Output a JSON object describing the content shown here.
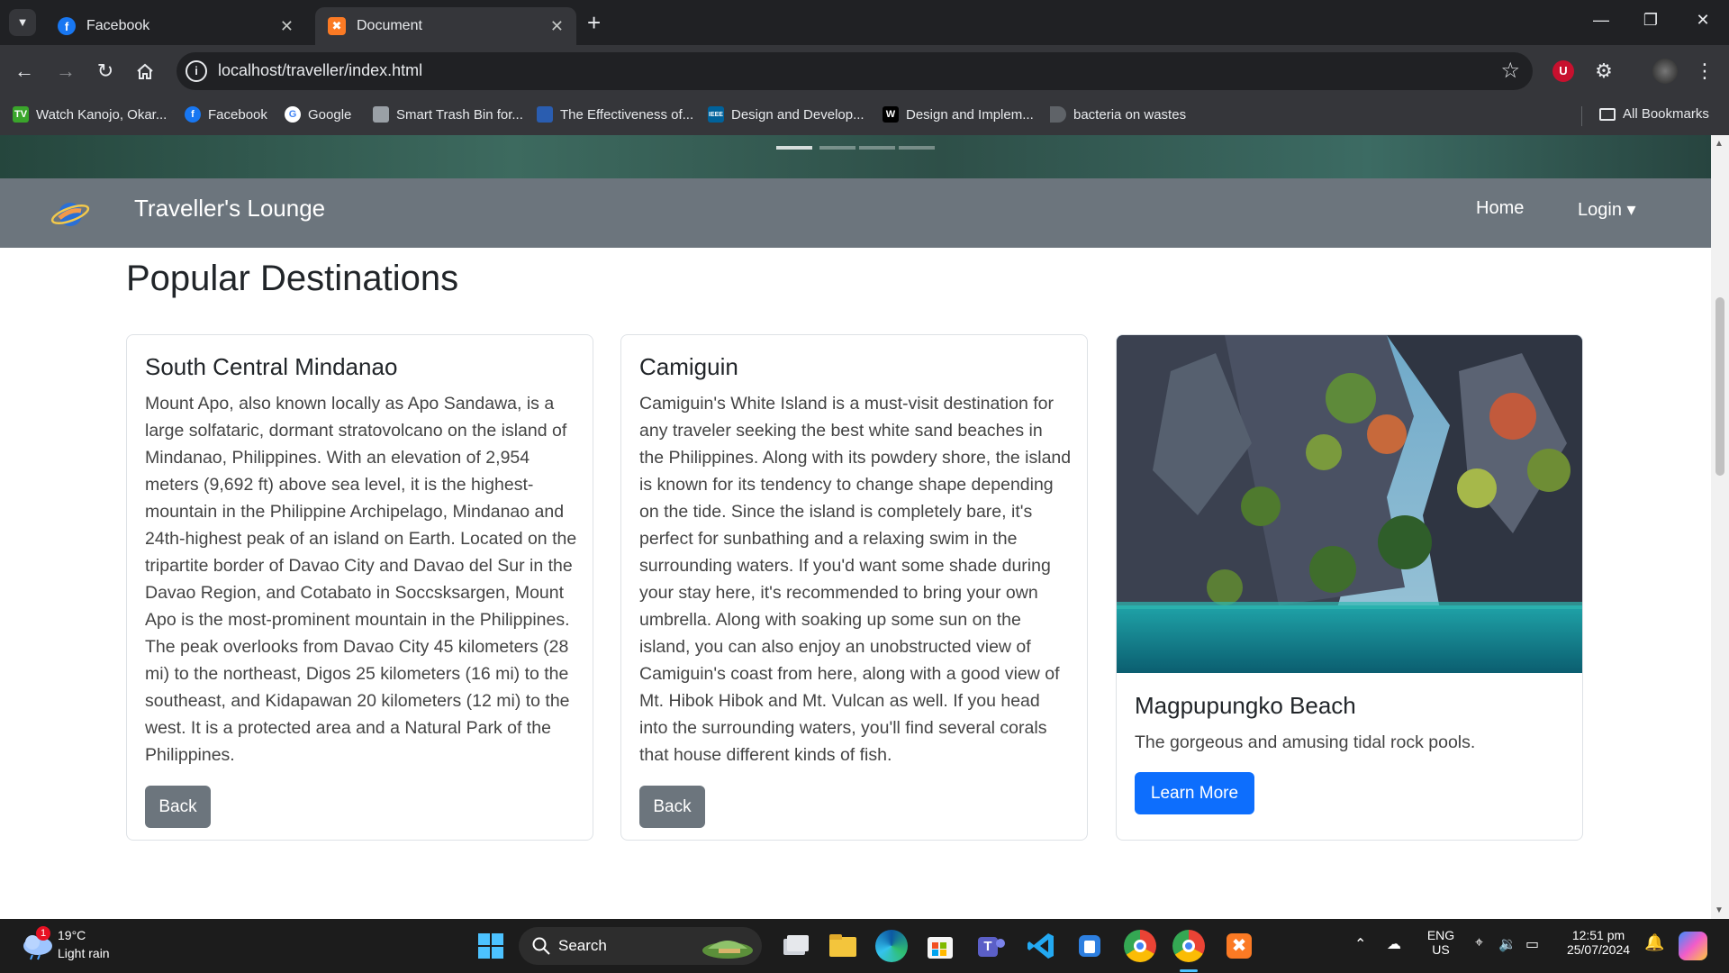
{
  "browser": {
    "tabs": [
      {
        "label": "Facebook",
        "active": false
      },
      {
        "label": "Document",
        "active": true
      }
    ],
    "new_tab_glyph": "+",
    "address": "localhost/traveller/index.html",
    "bookmarks": [
      "Watch Kanojo, Okar...",
      "Facebook",
      "Google",
      "Smart Trash Bin for...",
      "The Effectiveness of...",
      "Design and Develop...",
      "Design and Implem...",
      "bacteria on wastes"
    ],
    "all_bookmarks": "All Bookmarks",
    "bookmark_icon_text": {
      "tv": "TV",
      "ieee": "IEEE",
      "w": "W",
      "f": "f",
      "g": "G"
    }
  },
  "navbar": {
    "brand": "Traveller's Lounge",
    "home": "Home",
    "login": "Login ▾"
  },
  "section_title": "Popular Destinations",
  "cards": [
    {
      "title": "South Central Mindanao",
      "text": "Mount Apo, also known locally as Apo Sandawa, is a large solfataric, dormant stratovolcano on the island of Mindanao, Philippines. With an elevation of 2,954 meters (9,692 ft) above sea level, it is the highest-mountain in the Philippine Archipelago, Mindanao and 24th-highest peak of an island on Earth. Located on the tripartite border of Davao City and Davao del Sur in the Davao Region, and Cotabato in Soccsksargen, Mount Apo is the most-prominent mountain in the Philippines. The peak overlooks from Davao City 45 kilometers (28 mi) to the northeast, Digos 25 kilometers (16 mi) to the southeast, and Kidapawan 20 kilometers (12 mi) to the west. It is a protected area and a Natural Park of the Philippines.",
      "button": "Back"
    },
    {
      "title": "Camiguin",
      "text": "Camiguin's White Island is a must-visit destination for any traveler seeking the best white sand beaches in the Philippines. Along with its powdery shore, the island is known for its tendency to change shape depending on the tide. Since the island is completely bare, it's perfect for sunbathing and a relaxing swim in the surrounding waters. If you'd want some shade during your stay here, it's recommended to bring your own umbrella. Along with soaking up some sun on the island, you can also enjoy an unobstructed view of Camiguin's coast from here, along with a good view of Mt. Hibok Hibok and Mt. Vulcan as well. If you head into the surrounding waters, you'll find several corals that house different kinds of fish.",
      "button": "Back"
    },
    {
      "title": "Magpupungko Beach",
      "text": "The gorgeous and amusing tidal rock pools.",
      "button": "Learn More"
    }
  ],
  "taskbar": {
    "weather_badge": "1",
    "temperature": "19°C",
    "weather": "Light rain",
    "search": "Search",
    "lang_top": "ENG",
    "lang_bottom": "US",
    "time": "12:51 pm",
    "date": "25/07/2024"
  },
  "colors": {
    "navbar": "#6c757d",
    "primary": "#0d6efd",
    "secondary": "#6c757d",
    "chrome_dark": "#202124",
    "chrome_toolbar": "#35363a"
  }
}
